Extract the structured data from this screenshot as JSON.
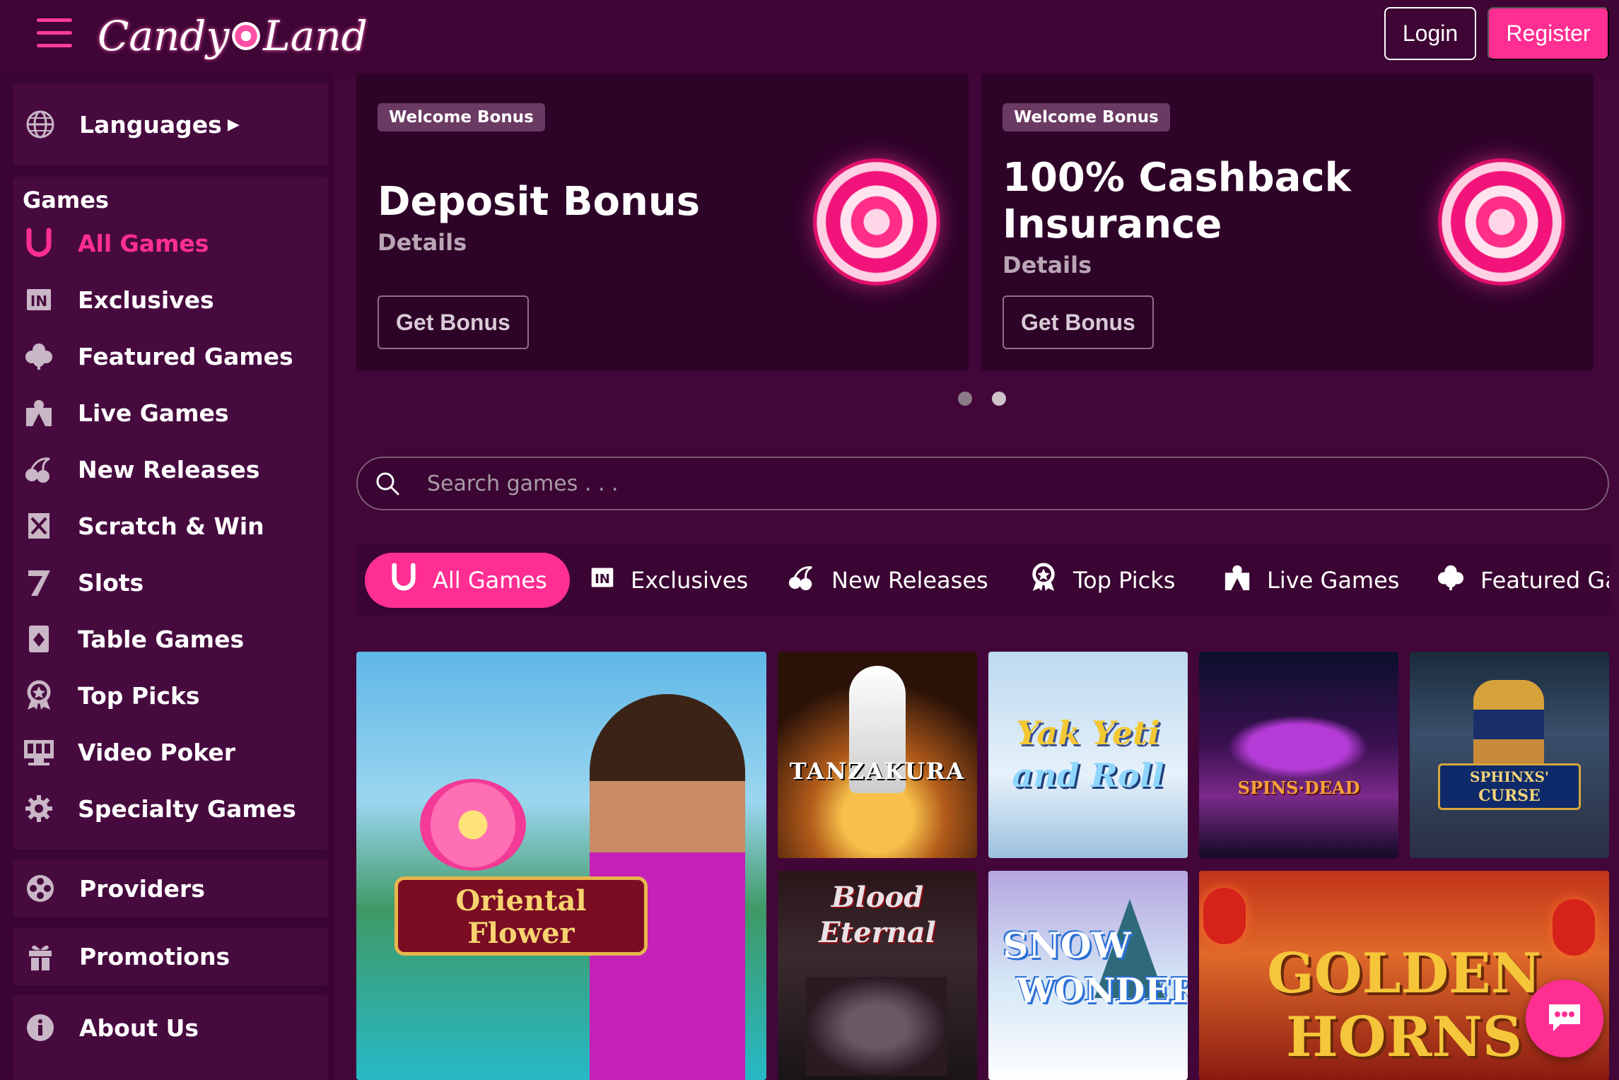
{
  "header": {
    "logo_text_left": "Candy",
    "logo_text_right": "Land",
    "login_label": "Login",
    "register_label": "Register"
  },
  "sidebar": {
    "languages_label": "Languages",
    "games_heading": "Games",
    "games": [
      {
        "label": "All Games",
        "icon": "horseshoe-icon",
        "active": true
      },
      {
        "label": "Exclusives",
        "icon": "exclusive-icon"
      },
      {
        "label": "Featured Games",
        "icon": "clover-icon"
      },
      {
        "label": "Live Games",
        "icon": "live-dealer-icon"
      },
      {
        "label": "New Releases",
        "icon": "cherries-icon"
      },
      {
        "label": "Scratch & Win",
        "icon": "scratch-card-icon"
      },
      {
        "label": "Slots",
        "icon": "seven-icon"
      },
      {
        "label": "Table Games",
        "icon": "playing-card-icon"
      },
      {
        "label": "Top Picks",
        "icon": "award-icon"
      },
      {
        "label": "Video Poker",
        "icon": "video-poker-icon"
      },
      {
        "label": "Specialty Games",
        "icon": "gear-icon"
      }
    ],
    "providers_label": "Providers",
    "promotions_label": "Promotions",
    "about_label": "About Us"
  },
  "promos": [
    {
      "badge": "Welcome Bonus",
      "title_line1": "Deposit Bonus",
      "title_line2": "",
      "details": "Details",
      "button": "Get Bonus"
    },
    {
      "badge": "Welcome Bonus",
      "title_line1": "100% Cashback",
      "title_line2": "Insurance",
      "details": "Details",
      "button": "Get Bonus"
    }
  ],
  "search": {
    "placeholder": "Search games . . ."
  },
  "tabs": [
    {
      "label": "All Games",
      "icon": "horseshoe-icon",
      "active": true
    },
    {
      "label": "Exclusives",
      "icon": "exclusive-icon"
    },
    {
      "label": "New Releases",
      "icon": "cherries-icon"
    },
    {
      "label": "Top Picks",
      "icon": "award-icon"
    },
    {
      "label": "Live Games",
      "icon": "live-dealer-icon"
    },
    {
      "label": "Featured Ga",
      "icon": "clover-icon"
    }
  ],
  "games": [
    {
      "title_line1": "Oriental",
      "title_line2": "Flower"
    },
    {
      "title_line1": "TANZAKURA"
    },
    {
      "title_line1": "Yak Yeti",
      "title_line2": "and Roll"
    },
    {
      "title_line1": "SPINS·DEAD"
    },
    {
      "title_line1": "SPHINXS'",
      "title_line2": "CURSE"
    },
    {
      "title_line1": "Blood",
      "title_line2": "Eternal"
    },
    {
      "title_line1": "SNOW",
      "title_line2": "WONDER"
    },
    {
      "title_line1": "GOLDEN",
      "title_line2": "HORNS"
    }
  ],
  "colors": {
    "accent": "#ff2e92",
    "background": "#420639",
    "sidebar": "#3a0532"
  }
}
